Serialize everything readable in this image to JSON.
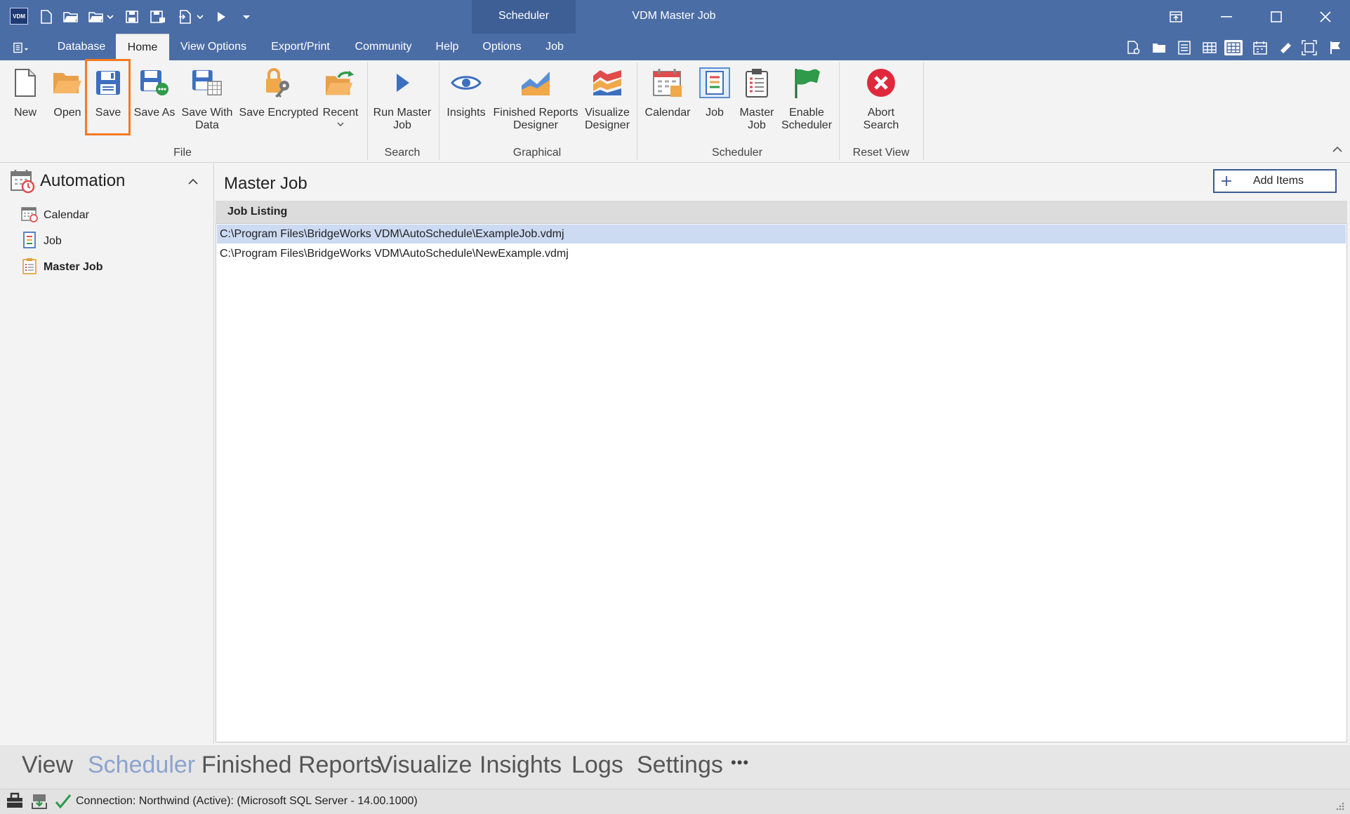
{
  "titlebar": {
    "logo_text": "VDM",
    "context_group": "Scheduler",
    "window_title": "VDM Master Job"
  },
  "tabs": [
    "Database",
    "Home",
    "View Options",
    "Export/Print",
    "Community",
    "Help",
    "Options",
    "Job"
  ],
  "active_tab": "Home",
  "ribbon": {
    "file": {
      "new": "New",
      "open": "Open",
      "save": "Save",
      "save_as": "Save As",
      "save_with_data": "Save With\nData",
      "save_encrypted": "Save Encrypted",
      "recent": "Recent",
      "group": "File"
    },
    "search": {
      "run_master_job": "Run Master\nJob",
      "group": "Search"
    },
    "graphical": {
      "insights": "Insights",
      "finished_reports_designer": "Finished Reports\nDesigner",
      "visualize_designer": "Visualize\nDesigner",
      "group": "Graphical"
    },
    "scheduler": {
      "calendar": "Calendar",
      "job": "Job",
      "master_job": "Master\nJob",
      "enable_scheduler": "Enable\nScheduler",
      "group": "Scheduler"
    },
    "reset_view": {
      "abort_search": "Abort\nSearch",
      "group": "Reset View"
    }
  },
  "sidebar": {
    "title": "Automation",
    "items": [
      {
        "label": "Calendar",
        "icon": "calendar-icon"
      },
      {
        "label": "Job",
        "icon": "job-icon"
      },
      {
        "label": "Master Job",
        "icon": "master-job-icon",
        "selected": true
      }
    ]
  },
  "content": {
    "title": "Master Job",
    "add_items": "Add Items",
    "listing_header": "Job Listing",
    "rows": [
      "C:\\Program Files\\BridgeWorks VDM\\AutoSchedule\\ExampleJob.vdmj",
      "C:\\Program Files\\BridgeWorks VDM\\AutoSchedule\\NewExample.vdmj"
    ]
  },
  "bottom_nav": {
    "items": [
      "View",
      "Scheduler",
      "Finished Reports",
      "Visualize",
      "Insights",
      "Logs",
      "Settings"
    ],
    "more": "•••",
    "active": "Scheduler"
  },
  "status": {
    "connection": "Connection: Northwind (Active): (Microsoft SQL Server - 14.00.1000)"
  },
  "colors": {
    "titlebar": "#4b6da6",
    "highlight": "#f47a20",
    "selected_row": "#ccdaf2",
    "bottom_active": "#8ba3cf"
  }
}
